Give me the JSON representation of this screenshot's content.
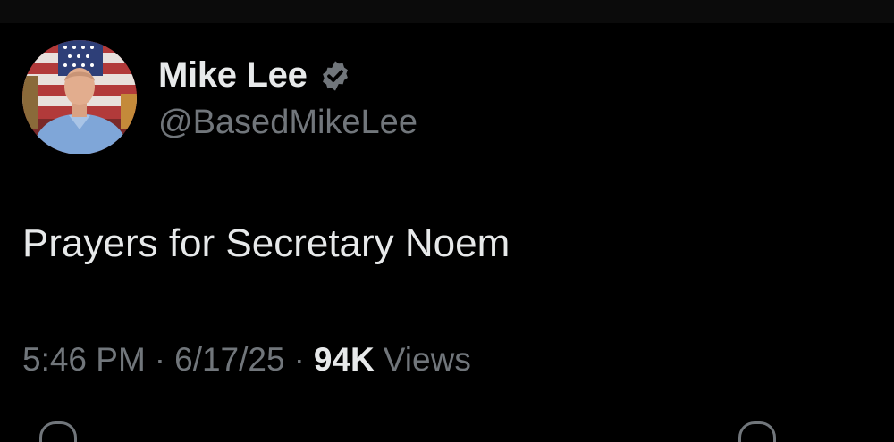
{
  "author": {
    "display_name": "Mike Lee",
    "handle": "@BasedMikeLee",
    "verified": true,
    "verified_color": "#71767b"
  },
  "tweet": {
    "text": "Prayers for Secretary Noem"
  },
  "meta": {
    "time": "5:46 PM",
    "separator": "·",
    "date": "6/17/25",
    "views_count": "94K",
    "views_label": "Views"
  },
  "colors": {
    "background": "#000000",
    "primary_text": "#e7e9ea",
    "secondary_text": "#71767b"
  },
  "icons": [
    "avatar-image",
    "verified-badge-icon",
    "action-icon"
  ]
}
